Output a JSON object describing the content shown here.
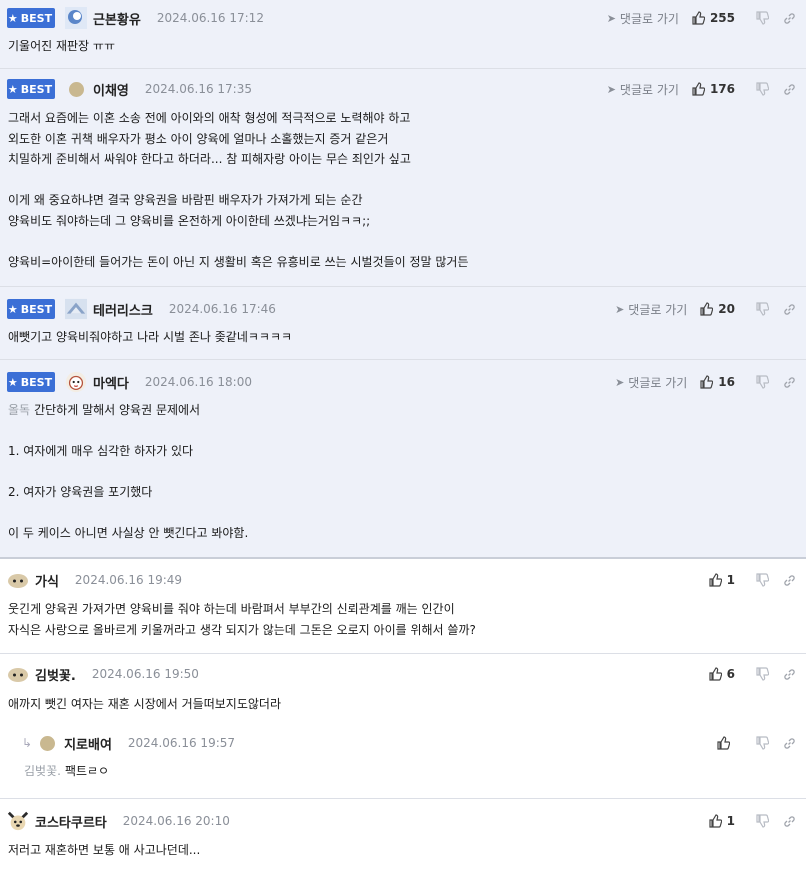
{
  "ui": {
    "goto_label": "댓글로 가기",
    "best_label": "BEST"
  },
  "comments": [
    {
      "nick": "근본황유",
      "date": "2024.06.16 17:12",
      "likes": "255",
      "text": "기울어진 재판장 ㅠㅠ"
    },
    {
      "nick": "이채영",
      "date": "2024.06.16 17:35",
      "likes": "176",
      "text": "그래서 요즘에는 이혼 소송 전에 아이와의 애착 형성에 적극적으로 노력해야 하고\n외도한 이혼 귀책 배우자가 평소 아이 양육에 얼마나 소홀했는지 증거 같은거\n치밀하게 준비해서 싸워야 한다고 하더라... 참 피해자랑 아이는 무슨 죄인가 싶고\n\n이게 왜 중요하냐면 결국 양육권을 바람핀 배우자가 가져가게 되는 순간\n양육비도 줘야하는데 그 양육비를 온전하게 아이한테 쓰겠냐는거임ㅋㅋ;;\n\n양육비=아이한테 들어가는 돈이 아닌 지 생활비 혹은 유흥비로 쓰는 시벌것들이 정말 많거든"
    },
    {
      "nick": "테러리스크",
      "date": "2024.06.16 17:46",
      "likes": "20",
      "text": "애뺏기고 양육비줘야하고 나라 시벌 존나 좆같네ㅋㅋㅋㅋ"
    },
    {
      "nick": "마엑다",
      "date": "2024.06.16 18:00",
      "likes": "16",
      "mention": "올독",
      "text": "간단하게 말해서 양육권 문제에서\n\n1. 여자에게 매우 심각한 하자가 있다\n\n2. 여자가 양육권을 포기했다\n\n이 두 케이스 아니면 사실상 안 뺏긴다고 봐야함."
    },
    {
      "nick": "가식",
      "date": "2024.06.16 19:49",
      "likes": "1",
      "text": "웃긴게 양육권 가져가면 양육비를 줘야 하는데 바람펴서 부부간의 신뢰관계를 깨는 인간이\n자식은 사랑으로 올바르게 키울꺼라고 생각 되지가 않는데 그돈은 오로지 아이를 위해서 쓸까?"
    },
    {
      "nick": "김벚꽃.",
      "date": "2024.06.16 19:50",
      "likes": "6",
      "text": "애까지 뺏긴 여자는 재혼 시장에서 거들떠보지도않더라"
    },
    {
      "nick": "지로배여",
      "date": "2024.06.16 19:57",
      "likes": "",
      "mention": "김벚꽃.",
      "text": "팩트ㄹㅇ"
    },
    {
      "nick": "코스타쿠르타",
      "date": "2024.06.16 20:10",
      "likes": "1",
      "text": "저러고 재혼하면 보통 애 사고나던데..."
    }
  ]
}
